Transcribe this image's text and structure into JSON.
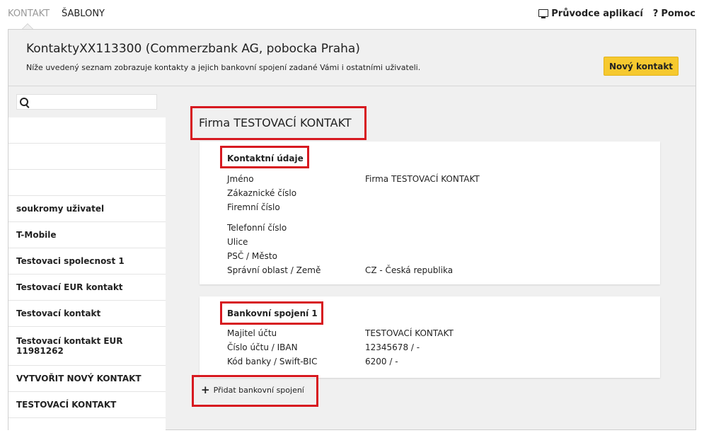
{
  "topnav": {
    "tabs": [
      {
        "label": "KONTAKT"
      },
      {
        "label": "ŠABLONY"
      }
    ]
  },
  "toplinks": {
    "guide": "Průvodce aplikací",
    "help": "Pomoc"
  },
  "header": {
    "title": "KontaktyXX113300 (Commerzbank AG, pobocka Praha)",
    "subtitle": "Níže uvedený seznam zobrazuje kontakty a jejich bankovní spojení zadané Vámi i ostatními uživateli.",
    "new_contact": "Nový kontakt"
  },
  "sidebar": {
    "search": {
      "value": "",
      "placeholder": ""
    },
    "items": [
      {
        "label": ""
      },
      {
        "label": ""
      },
      {
        "label": ""
      },
      {
        "label": "soukromy uživatel"
      },
      {
        "label": "T-Mobile"
      },
      {
        "label": "Testovaci spolecnost 1"
      },
      {
        "label": "Testovací EUR kontakt"
      },
      {
        "label": "Testovací kontakt"
      },
      {
        "label": "Testovací kontakt EUR 11981262"
      },
      {
        "label": "VYTVOŘIT NOVÝ KONTAKT"
      },
      {
        "label": "TESTOVACÍ KONTAKT"
      }
    ]
  },
  "detail": {
    "title": "Firma TESTOVACÍ KONTAKT",
    "contact": {
      "heading": "Kontaktní údaje",
      "rows": [
        {
          "label": "Jméno",
          "value": "Firma TESTOVACÍ KONTAKT"
        },
        {
          "label": "Zákaznické číslo",
          "value": ""
        },
        {
          "label": "Firemní číslo",
          "value": ""
        },
        {
          "label": "Telefonní číslo",
          "value": ""
        },
        {
          "label": "Ulice",
          "value": ""
        },
        {
          "label": "PSČ / Město",
          "value": ""
        },
        {
          "label": "Správní oblast / Země",
          "value": "CZ - Česká republika"
        }
      ]
    },
    "bank": {
      "heading": "Bankovní spojení 1",
      "rows": [
        {
          "label": "Majitel účtu",
          "value": "TESTOVACÍ KONTAKT"
        },
        {
          "label": "Číslo účtu / IBAN",
          "value": "12345678 / -"
        },
        {
          "label": "Kód banky / Swift-BIC",
          "value": "6200 / -"
        }
      ]
    },
    "add_bank": "Přidat bankovní spojení"
  },
  "colors": {
    "accent": "#f6c92f",
    "highlight": "#d71920",
    "panel": "#f0f0f0"
  },
  "icons": {
    "guide": "monitor-icon",
    "help": "question-icon",
    "search": "search-icon",
    "add": "plus-icon"
  }
}
